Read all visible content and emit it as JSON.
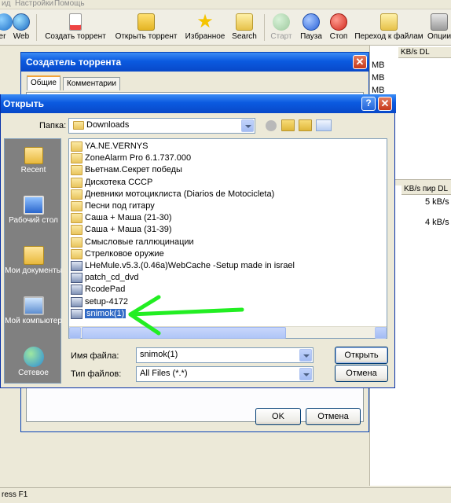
{
  "menubar": {
    "items": [
      "ид",
      "Настройки",
      "Помощь"
    ]
  },
  "toolbar": {
    "buttons": [
      {
        "label": "er",
        "icon": "globe-icon",
        "enabled": true
      },
      {
        "label": "Web",
        "icon": "globe-icon",
        "enabled": true
      },
      {
        "label": "Создать торрент",
        "icon": "new-torrent-icon",
        "enabled": true
      },
      {
        "label": "Открыть торрент",
        "icon": "open-torrent-icon",
        "enabled": true
      },
      {
        "label": "Избранное",
        "icon": "star-icon",
        "enabled": true
      },
      {
        "label": "Search",
        "icon": "search-icon",
        "enabled": true
      },
      {
        "label": "Старт",
        "icon": "play-icon",
        "enabled": false
      },
      {
        "label": "Пауза",
        "icon": "pause-icon",
        "enabled": true
      },
      {
        "label": "Стоп",
        "icon": "stop-icon",
        "enabled": true
      },
      {
        "label": "Переход к файлам",
        "icon": "goto-files-icon",
        "enabled": true
      },
      {
        "label": "Опции",
        "icon": "options-icon",
        "enabled": true
      }
    ]
  },
  "main_list": {
    "header1": "KB/s DL",
    "rows1": [
      "MB",
      "MB",
      "MB"
    ],
    "header2": "KB/s пир DL",
    "rows2": [
      "5 kB/s",
      "4 kB/s"
    ]
  },
  "status_bar": {
    "text": "ress F1"
  },
  "creator_dialog": {
    "title": "Создатель торрента",
    "tabs": [
      "Общие",
      "Комментарии"
    ],
    "ok_label": "OK",
    "cancel_label": "Отмена"
  },
  "open_dialog": {
    "title": "Открыть",
    "folder_label": "Папка:",
    "folder_value": "Downloads",
    "places": [
      {
        "label": "Recent",
        "icon": "recent-folder-icon"
      },
      {
        "label": "Рабочий стол",
        "icon": "desktop-icon"
      },
      {
        "label": "Мои документы",
        "icon": "my-documents-icon"
      },
      {
        "label": "Мой компьютер",
        "icon": "my-computer-icon"
      },
      {
        "label": "Сетевое",
        "icon": "network-icon"
      }
    ],
    "files": [
      {
        "name": "YA.NE.VERNYS",
        "type": "folder"
      },
      {
        "name": "ZoneAlarm Pro 6.1.737.000",
        "type": "folder"
      },
      {
        "name": "Вьетнам.Секрет победы",
        "type": "folder"
      },
      {
        "name": "Дискотека СССР",
        "type": "folder"
      },
      {
        "name": "Дневники мотоциклиста  (Diarios de Motocicleta)",
        "type": "folder"
      },
      {
        "name": "Песни под гитару",
        "type": "folder"
      },
      {
        "name": "Саша + Маша (21-30)",
        "type": "folder"
      },
      {
        "name": "Саша + Маша (31-39)",
        "type": "folder"
      },
      {
        "name": "Смысловые галлюцинации",
        "type": "folder"
      },
      {
        "name": "Стрелковое оружие",
        "type": "folder"
      },
      {
        "name": "LHeMule.v5.3.(0.46a)WebCache -Setup made in israel",
        "type": "app"
      },
      {
        "name": "patch_cd_dvd",
        "type": "app"
      },
      {
        "name": "RcodePad",
        "type": "app"
      },
      {
        "name": "setup-4172",
        "type": "app"
      },
      {
        "name": "snimok(1)",
        "type": "app",
        "selected": true
      }
    ],
    "filename_label": "Имя файла:",
    "filename_value": "snimok(1)",
    "filetype_label": "Тип файлов:",
    "filetype_value": "All Files (*.*)",
    "open_label": "Открыть",
    "cancel_label": "Отмена"
  },
  "colors": {
    "title_bar": "#0b5ae0",
    "annotation_arrow": "#22ee22",
    "selection": "#316ac5"
  }
}
